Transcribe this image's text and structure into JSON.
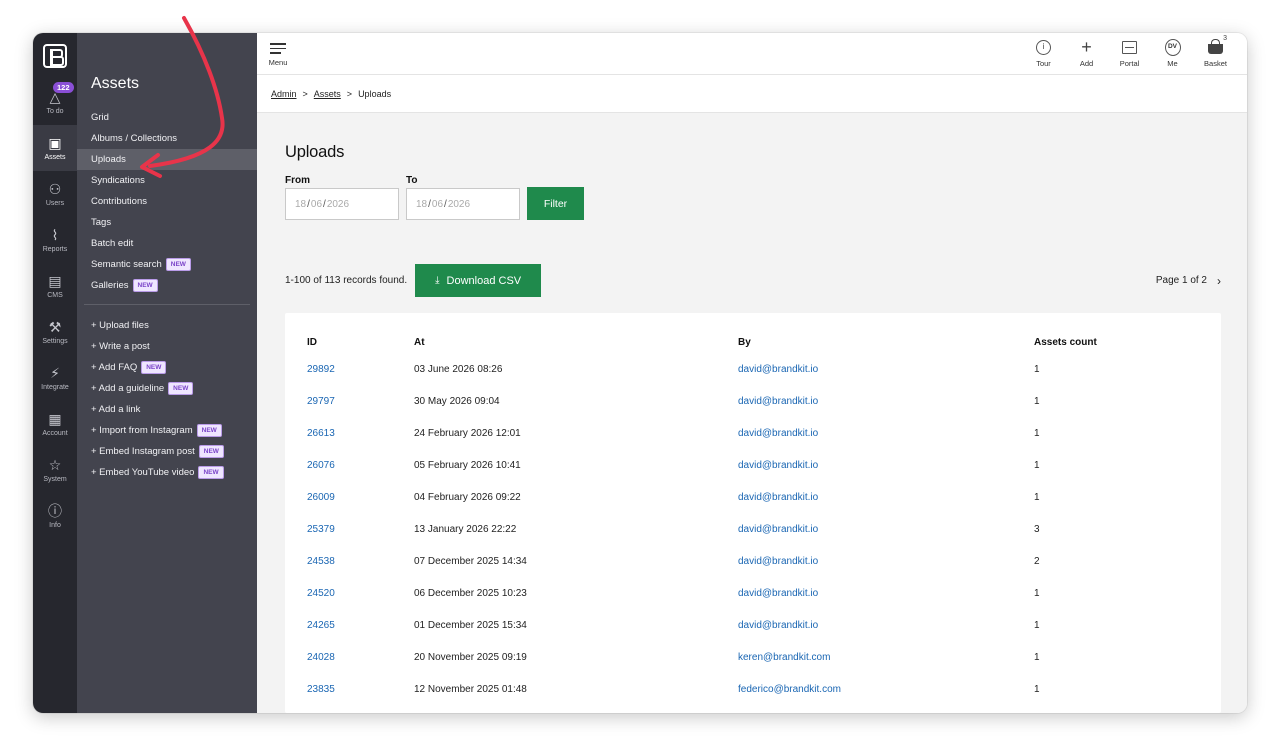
{
  "rail": {
    "todo_badge": "122",
    "items": [
      {
        "label": "To do",
        "icon": "warning-icon",
        "glyph": "△"
      },
      {
        "label": "Assets",
        "icon": "grid-icon",
        "glyph": "▣"
      },
      {
        "label": "Users",
        "icon": "users-icon",
        "glyph": "⚇"
      },
      {
        "label": "Reports",
        "icon": "pulse-icon",
        "glyph": "⌇"
      },
      {
        "label": "CMS",
        "icon": "cms-icon",
        "glyph": "▤"
      },
      {
        "label": "Settings",
        "icon": "wrench-icon",
        "glyph": "⚒"
      },
      {
        "label": "Integrate",
        "icon": "plug-icon",
        "glyph": "⚡"
      },
      {
        "label": "Account",
        "icon": "account-icon",
        "glyph": "▦"
      },
      {
        "label": "System",
        "icon": "star-icon",
        "glyph": "☆"
      },
      {
        "label": "Info",
        "icon": "help-icon",
        "glyph": "ⓘ"
      }
    ]
  },
  "subnav": {
    "title": "Assets",
    "items": [
      {
        "label": "Grid"
      },
      {
        "label": "Albums / Collections"
      },
      {
        "label": "Uploads"
      },
      {
        "label": "Syndications"
      },
      {
        "label": "Contributions"
      },
      {
        "label": "Tags"
      },
      {
        "label": "Batch edit"
      },
      {
        "label": "Semantic search",
        "tag": "NEW"
      },
      {
        "label": "Galleries",
        "tag": "NEW"
      }
    ],
    "actions": [
      {
        "label": "+ Upload files"
      },
      {
        "label": "+ Write a post"
      },
      {
        "label": "+ Add FAQ",
        "tag": "NEW"
      },
      {
        "label": "+ Add a guideline",
        "tag": "NEW"
      },
      {
        "label": "+ Add a link"
      },
      {
        "label": "+ Import from Instagram",
        "tag": "NEW"
      },
      {
        "label": "+ Embed Instagram post",
        "tag": "NEW"
      },
      {
        "label": "+ Embed YouTube video",
        "tag": "NEW"
      }
    ]
  },
  "topbar": {
    "menu_label": "Menu",
    "tour_label": "Tour",
    "add_label": "Add",
    "portal_label": "Portal",
    "me_label": "Me",
    "me_initials": "DV",
    "basket_label": "Basket",
    "basket_count": "3"
  },
  "breadcrumb": {
    "admin": "Admin",
    "assets": "Assets",
    "current": "Uploads",
    "sep": ">"
  },
  "page": {
    "title": "Uploads",
    "from_label": "From",
    "to_label": "To",
    "from_value": {
      "d": "18",
      "m": "06",
      "y": "2026"
    },
    "to_value": {
      "d": "18",
      "m": "06",
      "y": "2026"
    },
    "filter_label": "Filter",
    "records_text": "1-100 of 113 records found.",
    "csv_label": "Download CSV",
    "pager_text": "Page 1 of 2"
  },
  "table": {
    "headers": [
      "ID",
      "At",
      "By",
      "Assets count"
    ],
    "rows": [
      [
        "29892",
        "03 June 2026 08:26",
        "david@brandkit.io",
        "1"
      ],
      [
        "29797",
        "30 May 2026 09:04",
        "david@brandkit.io",
        "1"
      ],
      [
        "26613",
        "24 February 2026 12:01",
        "david@brandkit.io",
        "1"
      ],
      [
        "26076",
        "05 February 2026 10:41",
        "david@brandkit.io",
        "1"
      ],
      [
        "26009",
        "04 February 2026 09:22",
        "david@brandkit.io",
        "1"
      ],
      [
        "25379",
        "13 January 2026 22:22",
        "david@brandkit.io",
        "3"
      ],
      [
        "24538",
        "07 December 2025 14:34",
        "david@brandkit.io",
        "2"
      ],
      [
        "24520",
        "06 December 2025 10:23",
        "david@brandkit.io",
        "1"
      ],
      [
        "24265",
        "01 December 2025 15:34",
        "david@brandkit.io",
        "1"
      ],
      [
        "24028",
        "20 November 2025 09:19",
        "keren@brandkit.com",
        "1"
      ],
      [
        "23835",
        "12 November 2025 01:48",
        "federico@brandkit.com",
        "1"
      ]
    ]
  },
  "colors": {
    "accent_green": "#1f8a4c",
    "link_blue": "#1a66b3",
    "rail_bg": "#26272e",
    "subnav_bg": "#43444e",
    "badge_purple": "#8a4fd6",
    "annotation_red": "#e8344a"
  }
}
